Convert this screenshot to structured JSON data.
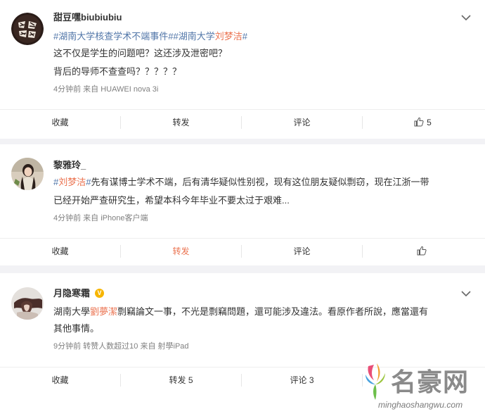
{
  "posts": [
    {
      "username": "甜豆嘿biubiubiu",
      "verified": false,
      "lines": [
        {
          "tag1": "#湖南大学核查学术不端事件#",
          "tag2": "#湖南大学",
          "name": "刘梦洁",
          "tag2_end": "#"
        },
        {
          "text": "这不仅是学生的问题吧？这还涉及泄密吧？"
        },
        {
          "text": "背后的导师不查查吗？？？？？"
        }
      ],
      "meta": "4分钟前 来自 HUAWEI nova 3i",
      "actions": {
        "collect": "收藏",
        "repost": "转发",
        "comment": "评论",
        "likes": "5"
      }
    },
    {
      "username": "黎雅玲_",
      "verified": false,
      "lines": [
        {
          "tag_open": "#",
          "name": "刘梦洁",
          "tag_close": "#",
          "text": "先有谋博士学术不端，后有清华疑似性别视，现有这位朋友疑似剽窃，现在江浙一带"
        },
        {
          "text": "已经开始严查研究生，希望本科今年毕业不要太过于艰难..."
        }
      ],
      "meta": "4分钟前 来自 iPhone客户端",
      "actions": {
        "collect": "收藏",
        "repost": "转发",
        "comment": "评论",
        "likes": ""
      }
    },
    {
      "username": "月隐寒霜",
      "verified": true,
      "verified_mark": "V",
      "lines": [
        {
          "prefix": "湖南大學",
          "name": "劉夢潔",
          "text": "剽竊論文一事，不光是剽竊問題，還可能涉及違法。看原作者所說，應當還有"
        },
        {
          "text": "其他事情。"
        }
      ],
      "meta": "9分钟前 转赞人数超过10 来自 射學iPad",
      "actions": {
        "collect": "收藏",
        "repost": "转发 5",
        "comment": "评论 3",
        "likes": ""
      }
    }
  ],
  "watermark": {
    "name": "名豪网",
    "url": "minghaoshangwu.com"
  },
  "colors": {
    "highlight": "#eb7350",
    "tag": "#5176a8",
    "meta": "#808080",
    "background": "#f2f2f5",
    "verified": "#f7b500"
  }
}
